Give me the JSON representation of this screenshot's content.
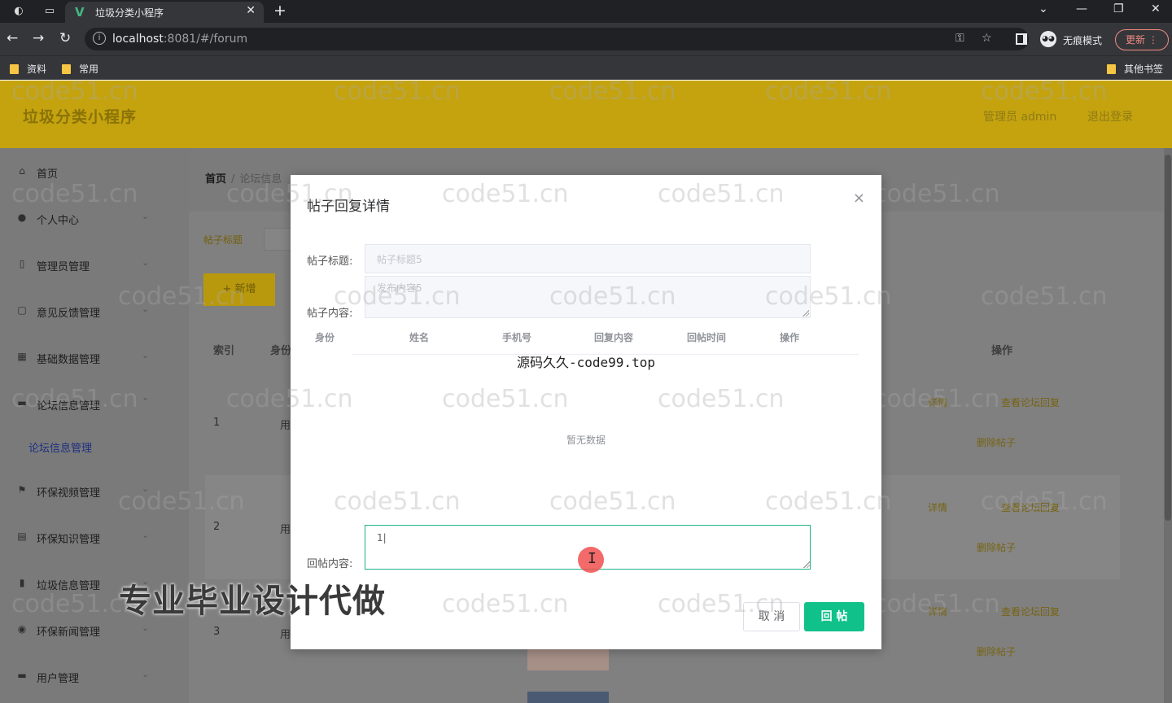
{
  "browser": {
    "tab_title": "垃圾分类小程序",
    "url_host": "localhost",
    "url_rest": ":8081/#/forum",
    "incognito_label": "无痕模式",
    "update_label": "更新",
    "bookmarks": [
      "资料",
      "常用"
    ],
    "other_bookmarks": "其他书签"
  },
  "header": {
    "app_title": "垃圾分类小程序",
    "admin_label": "管理员 admin",
    "logout_label": "退出登录"
  },
  "sidebar": {
    "items": [
      {
        "label": "首页",
        "icon": "home-icon"
      },
      {
        "label": "个人中心",
        "icon": "user-icon"
      },
      {
        "label": "管理员管理",
        "icon": "admin-icon"
      },
      {
        "label": "意见反馈管理",
        "icon": "feedback-icon"
      },
      {
        "label": "基础数据管理",
        "icon": "grid-icon"
      },
      {
        "label": "论坛信息管理",
        "icon": "forum-icon"
      },
      {
        "label": "环保视频管理",
        "icon": "flag-icon"
      },
      {
        "label": "环保知识管理",
        "icon": "book-icon"
      },
      {
        "label": "垃圾信息管理",
        "icon": "chart-icon"
      },
      {
        "label": "环保新闻管理",
        "icon": "news-icon"
      },
      {
        "label": "用户管理",
        "icon": "users-icon"
      }
    ],
    "active_sub": "论坛信息管理"
  },
  "main": {
    "breadcrumb_home": "首页",
    "breadcrumb_current": "论坛信息",
    "search_label": "帖子标题",
    "add_button": "+ 新增",
    "columns": [
      "索引",
      "身份",
      "操作"
    ],
    "rows": [
      {
        "index": "1",
        "identity": "用"
      },
      {
        "index": "2",
        "identity": "用"
      },
      {
        "index": "3",
        "identity": "用"
      }
    ],
    "op_detail": "详情",
    "op_view_replies": "查看论坛回复",
    "op_delete": "删除帖子"
  },
  "dialog": {
    "title": "帖子回复详情",
    "post_title_label": "帖子标题:",
    "post_title_value": "帖子标题5",
    "post_content_label": "帖子内容:",
    "post_content_value": "发布内容5",
    "columns": [
      "身份",
      "姓名",
      "手机号",
      "回复内容",
      "回帖时间",
      "操作"
    ],
    "empty_text": "暂无数据",
    "reply_label": "回帖内容:",
    "reply_value": "1|",
    "cancel_label": "取 消",
    "submit_label": "回 帖"
  },
  "overlays": {
    "watermark": "code51.cn",
    "center_text": "源码久久-code99.top",
    "promo_text": "专业毕业设计代做"
  }
}
